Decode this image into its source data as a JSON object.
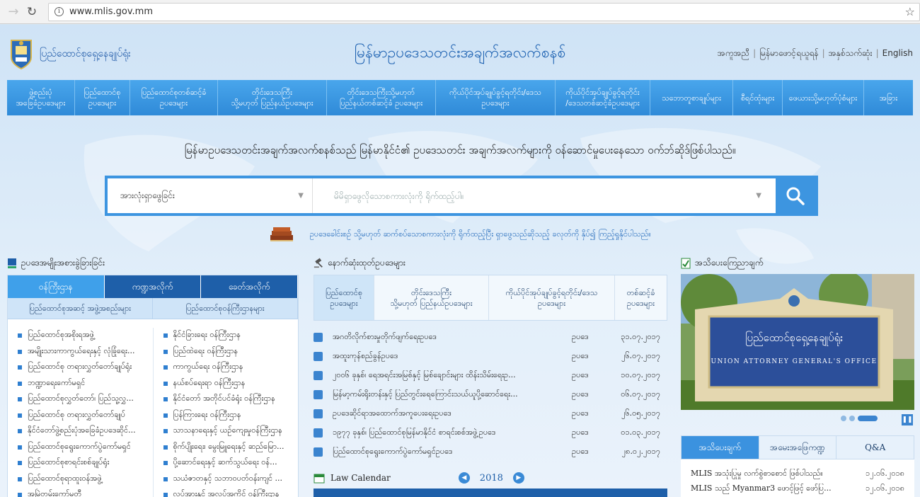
{
  "browser": {
    "url": "www.mlis.gov.mm"
  },
  "header": {
    "org_name": "ပြည်ထောင်စုရှေ့နေချုပ်ရုံး",
    "site_title": "မြန်မာဥပဒေသတင်းအချက်အလက်စနစ်",
    "links": [
      "အကူအညီ",
      "မြန်မာဖောင့်ရယူရန်",
      "အနှစ်သက်ဆုံး",
      "English"
    ]
  },
  "nav": {
    "items": [
      {
        "label": "ဖွဲ့စည်းပုံ\nအခြေခံဥပဒေများ",
        "w": 96
      },
      {
        "label": "ပြည်ထောင်စု\nဥပဒေများ",
        "w": 78
      },
      {
        "label": "ပြည်ထောင်စုတစ်ဆင့်ခံ\nဥပဒေများ",
        "w": 124
      },
      {
        "label": "တိုင်းဒေသကြီး\nသို့မဟုတ် ပြည်နယ်ဥပဒေများ",
        "w": 154
      },
      {
        "label": "တိုင်းဒေသကြီးသို့မဟုတ်\nပြည်နယ်တစ်ဆင့်ခံ ဥပဒေများ",
        "w": 154
      },
      {
        "label": "ကိုယ်ပိုင်အုပ်ချုပ်ခွင့်ရတိုင်း/ဒေသ\nဥပဒေများ",
        "w": 169
      },
      {
        "label": "ကိုယ်ပိုင်အုပ်ချုပ်ခွင့်ရတိုင်း\n/ဒေသတစ်ဆင့်ခံဥပဒေများ",
        "w": 134
      },
      {
        "label": "သဘောတူစာချုပ်များ",
        "w": 117
      },
      {
        "label": "စီရင်ထုံးများ",
        "w": 70
      },
      {
        "label": "ဖေယားသို့မဟုတ်ပုံစံများ",
        "w": 115
      },
      {
        "label": "အခြား",
        "w": 69
      }
    ]
  },
  "tagline": "မြန်မာဥပဒေသတင်းအချက်အလက်စနစ်သည် မြန်မာနိုင်ငံ၏ ဥပဒေသတင်း အချက်အလက်များကို ဝန်ဆောင်မှုပေးနေသော ဝက်ဘ်ဆိုဒ်ဖြစ်ပါသည်။",
  "search": {
    "scope": "အားလုံးရှာဖွေခြင်း",
    "placeholder": "မိမိရှာဖွေလိုသောစကားလုံးကို ရိုက်ထည့်ပါ။"
  },
  "hint": "ဥပဒေခေါင်းစဉ် သို့မဟုတ် ဆက်စပ်သောစကားလုံးကို ရိုက်ထည့်ပြီး ရှာဖွေသည်ဆိုသည့် ခလုတ်ကို နှိပ်၍ ကြည့်ရှုနိုင်ပါသည်။",
  "left_panel": {
    "title": "ဥပဒေအမျိုးအစားခွဲခြားခြင်း",
    "tabs": [
      "ဝန်ကြီးဌာန",
      "ကဏ္ဍအလိုက်",
      "ခေတ်အလိုက်"
    ],
    "sub_heads": [
      "ပြည်ထောင်စုအဆင့် အဖွဲ့အစည်းများ",
      "ပြည်ထောင်စုဝန်ကြီးဌာနများ"
    ],
    "col1": [
      "ပြည်ထောင်စုအစိုးရအဖွဲ့",
      "အမျိုးသားကာကွယ်ရေးနှင့် လုံခြုံရေး...",
      "ပြည်ထောင်စု တရားလွှတ်တော်ချုပ်ရုံး",
      "ဘဏ္ဍာရေးကော်မရှင်",
      "ပြည်ထောင်စုလွှတ်တော်၊ ပြည်သူ့လွှ...",
      "ပြည်ထောင်စု တရားလွှတ်တော်ချုပ်",
      "နိုင်ငံတော်ဖွဲ့စည်းပုံအခြေခံဥပဒေဆိုင်...",
      "ပြည်ထောင်စုရွေးကောက်ပွဲကော်မရှင်",
      "ပြည်ထောင်စုစာရင်းစစ်ချုပ်ရုံး",
      "ပြည်ထောင်စုရာထူးဝန်အဖွဲ့",
      "အမြဲတမ်းကော်မတီ"
    ],
    "col2": [
      "နိုင်ငံခြားရေး ဝန်ကြီးဌာန",
      "ပြည်ထဲရေး ဝန်ကြီးဌာန",
      "ကာကွယ်ရေး ဝန်ကြီးဌာန",
      "နယ်စပ်ရေးရာ ဝန်ကြီးဌာန",
      "နိုင်ငံတော် အတိုင်ပင်ခံရုံး ဝန်ကြီးဌာန",
      "ပြန်ကြားရေး ဝန်ကြီးဌာန",
      "သာသနာရေးနှင့် ယဉ်ကျေးမှုဝန်ကြီးဌာန",
      "စိုက်ပျိုးရေး၊ မွေးမြူရေးနှင့် ဆည်မြော...",
      "ပို့ဆောင်ရေးနှင့် ဆက်သွယ်ရေး ဝန်...",
      "သယံဇာတနှင့် သဘာဝပတ်ဝန်းကျင် ...",
      "လုပ်အားနှင့် အလုပ်အကိုင် ဝန်ကြီးဌာန"
    ]
  },
  "mid_panel": {
    "title": "နောက်ဆုံးထုတ်ဥပဒေများ",
    "tabs": [
      {
        "label": "ပြည်ထောင်စု\nဥပဒေများ",
        "w": 85
      },
      {
        "label": "တိုင်းဒေသကြီး\nသို့မဟုတ် ပြည်နယ်ဥပဒေများ",
        "w": 162
      },
      {
        "label": "ကိုယ်ပိုင်အုပ်ချုပ်ခွင့်ရတိုင်း/ဒေသ\nဥပဒေများ",
        "w": 178
      },
      {
        "label": "တစ်ဆင့်ခံ\nဥပဒေများ",
        "w": 73
      }
    ],
    "laws": [
      {
        "title": "အဂတိလိုက်စားမှုတိုက်ဖျက်ရေးဥပဒေ",
        "type": "ဥပဒေ",
        "date": "၃၁.၀၇.၂၀၁၇"
      },
      {
        "title": "အထူးကုန်စည်ခွန်ဥပဒေ",
        "type": "ဥပဒေ",
        "date": "၂၆.၀၇.၂၀၁၇"
      },
      {
        "title": "၂၀၀၆ ခုနှစ်၊ ရေအရင်းအမြစ်နှင့် မြစ်ချောင်းများ ထိန်းသိမ်းရေးဥ...",
        "type": "ဥပဒေ",
        "date": "၁၀.၀၇.၂၀၁၇"
      },
      {
        "title": "မြန်မာ့ကမ်းရိုးတန်းနှင့် ပြည်တွင်းရေကြောင်းသယ်ယူပို့ဆောင်ရေး...",
        "type": "ဥပဒေ",
        "date": "၀၆.၀၇.၂၀၁၇"
      },
      {
        "title": "ဥပဒေဆိုင်ရာအထောက်အကူပေးရေးဥပဒေ",
        "type": "ဥပဒေ",
        "date": "၂၆.၀၅.၂၀၁၇"
      },
      {
        "title": "၁၉၇၇ ခုနှစ်၊ ပြည်ထောင်စုမြန်မာနိုင်ငံ စာရင်းစစ်အဖွဲ့ဥပဒေ",
        "type": "ဥပဒေ",
        "date": "၀၁.၀၃.၂၀၁၇"
      },
      {
        "title": "ပြည်ထောင်စုရွေးကောက်ပွဲကော်မရှင်ဥပဒေ",
        "type": "ဥပဒေ",
        "date": "၂၈.၀၂.၂၀၁၇"
      }
    ],
    "calendar_title": "Law Calendar",
    "calendar_year": "2018"
  },
  "right_panel": {
    "title": "အသိပေးကြေညာချက်",
    "sign_text": "ပြည်ထောင်စုရှေ့နေချုပ်ရုံး",
    "sign_text_en": "UNION ATTORNEY GENERAL'S OFFICE",
    "tabs": [
      "အသိပေးချက်",
      "အမေးအဖြေကဏ္ဍ",
      "Q&A"
    ],
    "news": [
      {
        "title": "MLIS အသုံးပြုမှု လက်စွဲစာစောင် ဖြစ်ပါသည်။",
        "date": "၁၂.၀၆.၂၀၁၈"
      },
      {
        "title": "MLIS သည် Myanmar3 ဖောင့်ဖြင့် ဖော်ပြ...",
        "date": "၁၂.၀၆.၂၀၁၈"
      }
    ]
  },
  "colors": {
    "nav_blue": "#3a96e2",
    "tab_dark": "#1e5fa9",
    "accent": "#3b84cf"
  }
}
